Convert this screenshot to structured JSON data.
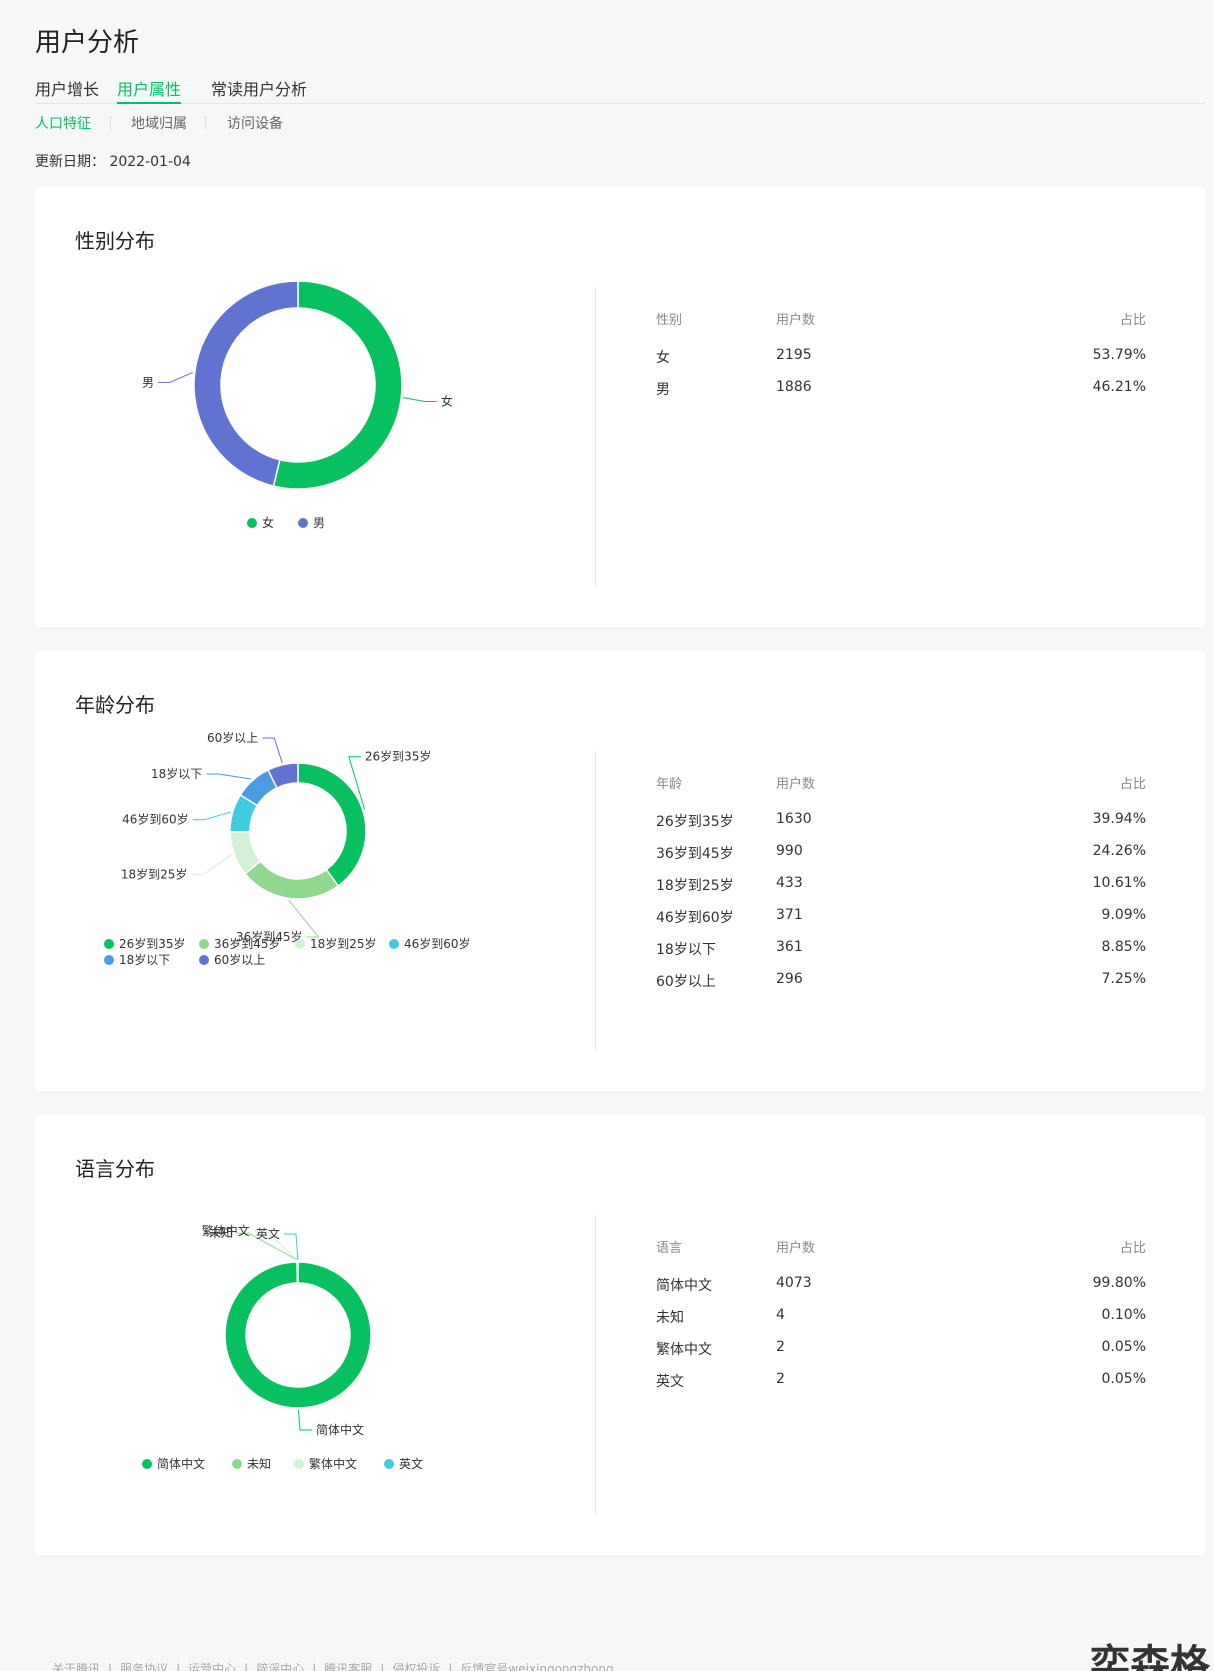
{
  "header": {
    "title": "用户分析",
    "tabs": [
      {
        "label": "用户增长"
      },
      {
        "label": "用户属性"
      },
      {
        "label": "常读用户分析"
      }
    ],
    "subtabs": [
      {
        "label": "人口特征"
      },
      {
        "label": "地域归属"
      },
      {
        "label": "访问设备"
      }
    ],
    "updated_label": "更新日期：",
    "updated_date": "2022-01-04"
  },
  "colors": {
    "accent": "#07c160",
    "female": "#07c160",
    "male": "#6173d0"
  },
  "gender": {
    "title": "性别分布",
    "headers": [
      "性别",
      "用户数",
      "占比"
    ],
    "rows": [
      {
        "label": "女",
        "count": "2195",
        "pct": "53.79%"
      },
      {
        "label": "男",
        "count": "1886",
        "pct": "46.21%"
      }
    ]
  },
  "age": {
    "title": "年龄分布",
    "headers": [
      "年龄",
      "用户数",
      "占比"
    ],
    "rows": [
      {
        "label": "26岁到35岁",
        "count": "1630",
        "pct": "39.94%"
      },
      {
        "label": "36岁到45岁",
        "count": "990",
        "pct": "24.26%"
      },
      {
        "label": "18岁到25岁",
        "count": "433",
        "pct": "10.61%"
      },
      {
        "label": "46岁到60岁",
        "count": "371",
        "pct": "9.09%"
      },
      {
        "label": "18岁以下",
        "count": "361",
        "pct": "8.85%"
      },
      {
        "label": "60岁以上",
        "count": "296",
        "pct": "7.25%"
      }
    ]
  },
  "language": {
    "title": "语言分布",
    "headers": [
      "语言",
      "用户数",
      "占比"
    ],
    "rows": [
      {
        "label": "简体中文",
        "count": "4073",
        "pct": "99.80%"
      },
      {
        "label": "未知",
        "count": "4",
        "pct": "0.10%"
      },
      {
        "label": "繁体中文",
        "count": "2",
        "pct": "0.05%"
      },
      {
        "label": "英文",
        "count": "2",
        "pct": "0.05%"
      }
    ]
  },
  "chart_data": [
    {
      "type": "pie",
      "categories": [
        "女",
        "男"
      ],
      "values": [
        2195,
        1886
      ],
      "colors": [
        "#07c160",
        "#6173d0"
      ],
      "legend": "bottom"
    },
    {
      "type": "pie",
      "categories": [
        "26岁到35岁",
        "36岁到45岁",
        "18岁到25岁",
        "46岁到60岁",
        "18岁以下",
        "60岁以上"
      ],
      "values": [
        1630,
        990,
        433,
        371,
        361,
        296
      ],
      "colors": [
        "#07c160",
        "#8fd88e",
        "#d3f1d7",
        "#3fcbe0",
        "#4c9be3",
        "#6173d0"
      ],
      "legend": "bottom"
    },
    {
      "type": "pie",
      "categories": [
        "简体中文",
        "未知",
        "繁体中文",
        "英文"
      ],
      "values": [
        4073,
        4,
        2,
        2
      ],
      "colors": [
        "#07c160",
        "#8fd88e",
        "#d3f1d7",
        "#3fcbe0"
      ],
      "legend": "bottom"
    }
  ],
  "footer": {
    "links": [
      "关于腾讯",
      "服务协议",
      "运营中心",
      "辟谣中心",
      "腾讯客服",
      "侵权投诉",
      "反馈官号weixingongzhong"
    ]
  },
  "watermark": "奕森格"
}
